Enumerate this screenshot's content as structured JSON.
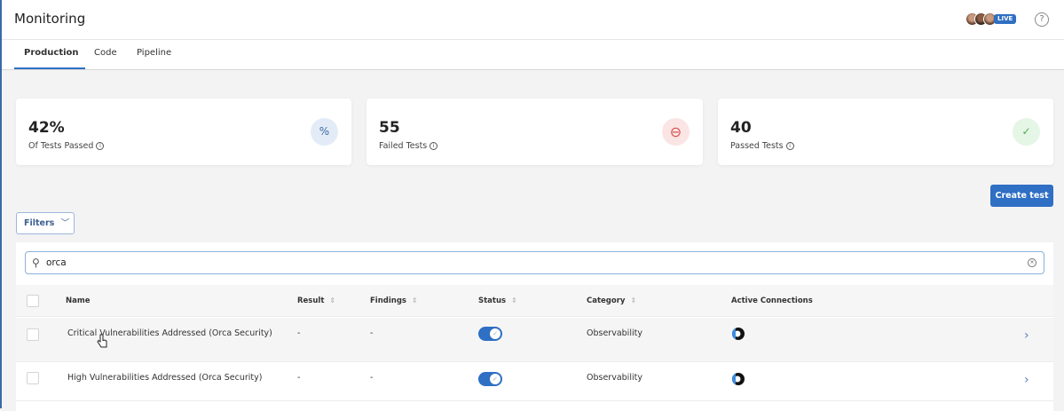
{
  "header": {
    "title": "Monitoring",
    "live_badge": "LIVE",
    "help_icon": "?"
  },
  "tabs": [
    {
      "label": "Production",
      "active": true
    },
    {
      "label": "Code"
    },
    {
      "label": "Pipeline"
    }
  ],
  "stats": [
    {
      "value": "42%",
      "label": "Of Tests Passed",
      "icon": "%",
      "icon_color": "#3b6aa6",
      "icon_bg": "#e3ecf6"
    },
    {
      "value": "55",
      "label": "Failed Tests",
      "icon": "⊖",
      "icon_color": "#d9534f",
      "icon_bg": "#fbe4e4"
    },
    {
      "value": "40",
      "label": "Passed Tests",
      "icon": "✓",
      "icon_color": "#4caf50",
      "icon_bg": "#e5f5e6"
    }
  ],
  "toolbar": {
    "create_label": "Create test",
    "filters_label": "Filters"
  },
  "search": {
    "value": "orca"
  },
  "table": {
    "columns": [
      "Name",
      "Result",
      "Findings",
      "Status",
      "Category",
      "Active Connections"
    ],
    "rows": [
      {
        "name": "Critical Vulnerabilities Addressed (Orca Security)",
        "result": "-",
        "findings": "-",
        "status": true,
        "category": "Observability"
      },
      {
        "name": "High Vulnerabilities Addressed (Orca Security)",
        "result": "-",
        "findings": "-",
        "status": true,
        "category": "Observability"
      }
    ]
  },
  "colors": {
    "accent": "#2f6fc4"
  }
}
